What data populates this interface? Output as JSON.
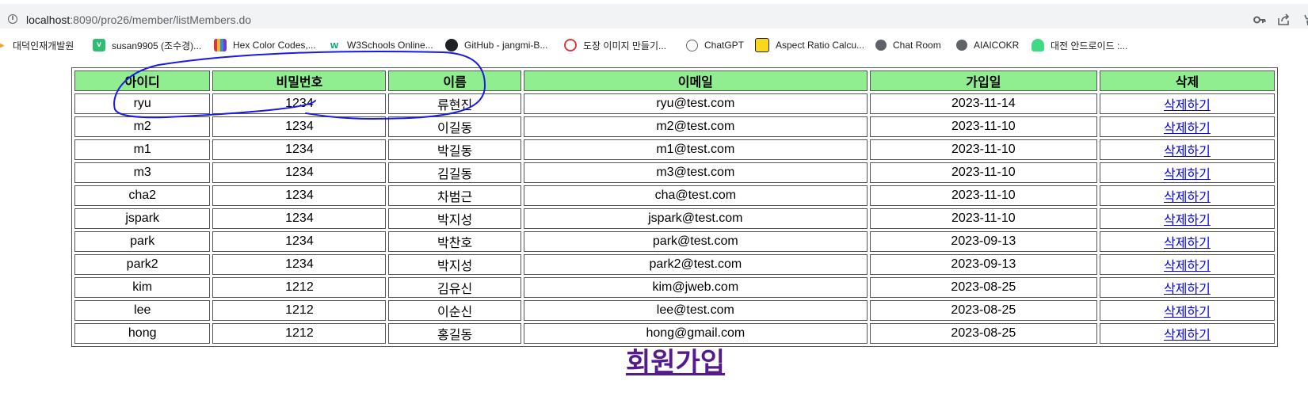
{
  "browser": {
    "url_host": "localhost",
    "url_rest": ":8090/pro26/member/listMembers.do"
  },
  "bookmarks": [
    {
      "label": "대덕인재개발원",
      "icon": "orange-flame-icon",
      "color": "#f4a12a"
    },
    {
      "label": "susan9905 (조수경)...",
      "icon": "v-icon",
      "color": "#2ebd72"
    },
    {
      "label": "Hex Color Codes,...",
      "icon": "color-book-icon",
      "color": "#d23a3a"
    },
    {
      "label": "W3Schools Online...",
      "icon": "w3-icon",
      "color": "#04aa6d"
    },
    {
      "label": "GitHub - jangmi-B...",
      "icon": "github-icon",
      "color": "#202124"
    },
    {
      "label": "도장 이미지 만들기...",
      "icon": "stamp-icon",
      "color": "#e0393e"
    },
    {
      "label": "ChatGPT",
      "icon": "chatgpt-icon",
      "color": "#5f6368"
    },
    {
      "label": "Aspect Ratio Calcu...",
      "icon": "aspect-ratio-icon",
      "color": "#202124"
    },
    {
      "label": "Chat Room",
      "icon": "globe-icon",
      "color": "#5f6368"
    },
    {
      "label": "AIAICOKR",
      "icon": "globe-icon",
      "color": "#5f6368"
    },
    {
      "label": "대전 안드로이드 :...",
      "icon": "android-icon",
      "color": "#3ddc84"
    }
  ],
  "table": {
    "headers": [
      "아이디",
      "비밀번호",
      "이름",
      "이메일",
      "가입일",
      "삭제"
    ],
    "rows": [
      {
        "id": "ryu",
        "pw": "1234",
        "name": "류현진",
        "email": "ryu@test.com",
        "date": "2023-11-14",
        "del": "삭제하기"
      },
      {
        "id": "m2",
        "pw": "1234",
        "name": "이길동",
        "email": "m2@test.com",
        "date": "2023-11-10",
        "del": "삭제하기"
      },
      {
        "id": "m1",
        "pw": "1234",
        "name": "박길동",
        "email": "m1@test.com",
        "date": "2023-11-10",
        "del": "삭제하기"
      },
      {
        "id": "m3",
        "pw": "1234",
        "name": "김길동",
        "email": "m3@test.com",
        "date": "2023-11-10",
        "del": "삭제하기"
      },
      {
        "id": "cha2",
        "pw": "1234",
        "name": "차범근",
        "email": "cha@test.com",
        "date": "2023-11-10",
        "del": "삭제하기"
      },
      {
        "id": "jspark",
        "pw": "1234",
        "name": "박지성",
        "email": "jspark@test.com",
        "date": "2023-11-10",
        "del": "삭제하기"
      },
      {
        "id": "park",
        "pw": "1234",
        "name": "박찬호",
        "email": "park@test.com",
        "date": "2023-09-13",
        "del": "삭제하기"
      },
      {
        "id": "park2",
        "pw": "1234",
        "name": "박지성",
        "email": "park2@test.com",
        "date": "2023-09-13",
        "del": "삭제하기"
      },
      {
        "id": "kim",
        "pw": "1212",
        "name": "김유신",
        "email": "kim@jweb.com",
        "date": "2023-08-25",
        "del": "삭제하기"
      },
      {
        "id": "lee",
        "pw": "1212",
        "name": "이순신",
        "email": "lee@test.com",
        "date": "2023-08-25",
        "del": "삭제하기"
      },
      {
        "id": "hong",
        "pw": "1212",
        "name": "홍길동",
        "email": "hong@gmail.com",
        "date": "2023-08-25",
        "del": "삭제하기"
      }
    ]
  },
  "signup_label": "회원가입",
  "colors": {
    "header_bg": "#90ee90",
    "link": "#0000ee",
    "visited_link": "#551a8b",
    "annotation_stroke": "#1a1ae6"
  }
}
